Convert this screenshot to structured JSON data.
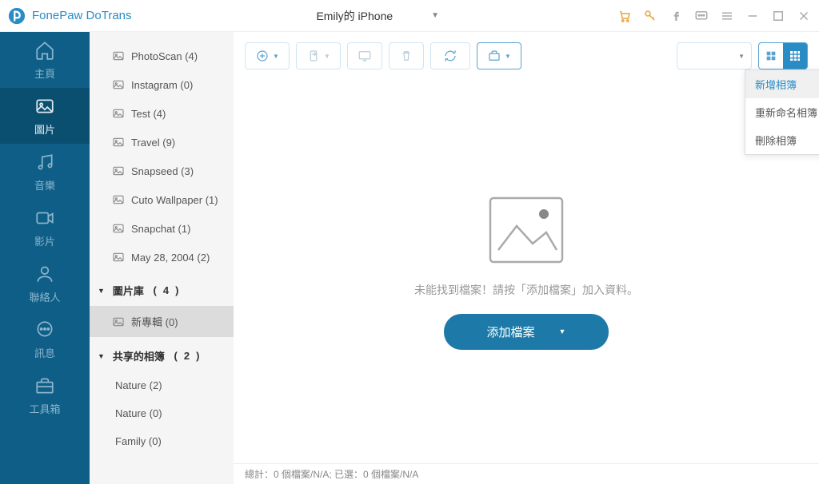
{
  "title": "FonePaw DoTrans",
  "device": "Emily的 iPhone",
  "nav": {
    "home": "主頁",
    "photos": "圖片",
    "music": "音樂",
    "videos": "影片",
    "contacts": "聯絡人",
    "messages": "訊息",
    "toolbox": "工具箱"
  },
  "albums": [
    {
      "name": "PhotoScan",
      "count": 4
    },
    {
      "name": "Instagram",
      "count": 0
    },
    {
      "name": "Test",
      "count": 4
    },
    {
      "name": "Travel",
      "count": 9
    },
    {
      "name": "Snapseed",
      "count": 3
    },
    {
      "name": "Cuto Wallpaper",
      "count": 1
    },
    {
      "name": "Snapchat",
      "count": 1
    },
    {
      "name": "May 28, 2004",
      "count": 2
    }
  ],
  "group_library": {
    "label": "圖片庫",
    "count": 4
  },
  "new_album": {
    "label": "新專輯",
    "count": 0
  },
  "group_shared": {
    "label": "共享的相簿",
    "count": 2
  },
  "shared": [
    {
      "name": "Nature",
      "count": 2
    },
    {
      "name": "Nature",
      "count": 0
    },
    {
      "name": "Family",
      "count": 0
    }
  ],
  "menu": {
    "add": "新增相簿",
    "rename": "重新命名相簿",
    "delete": "刪除相簿"
  },
  "empty_msg": "未能找到檔案！請按「添加檔案」加入資料。",
  "add_file": "添加檔案",
  "status": "總計：0 個檔案/N/A; 已選：0 個檔案/N/A"
}
